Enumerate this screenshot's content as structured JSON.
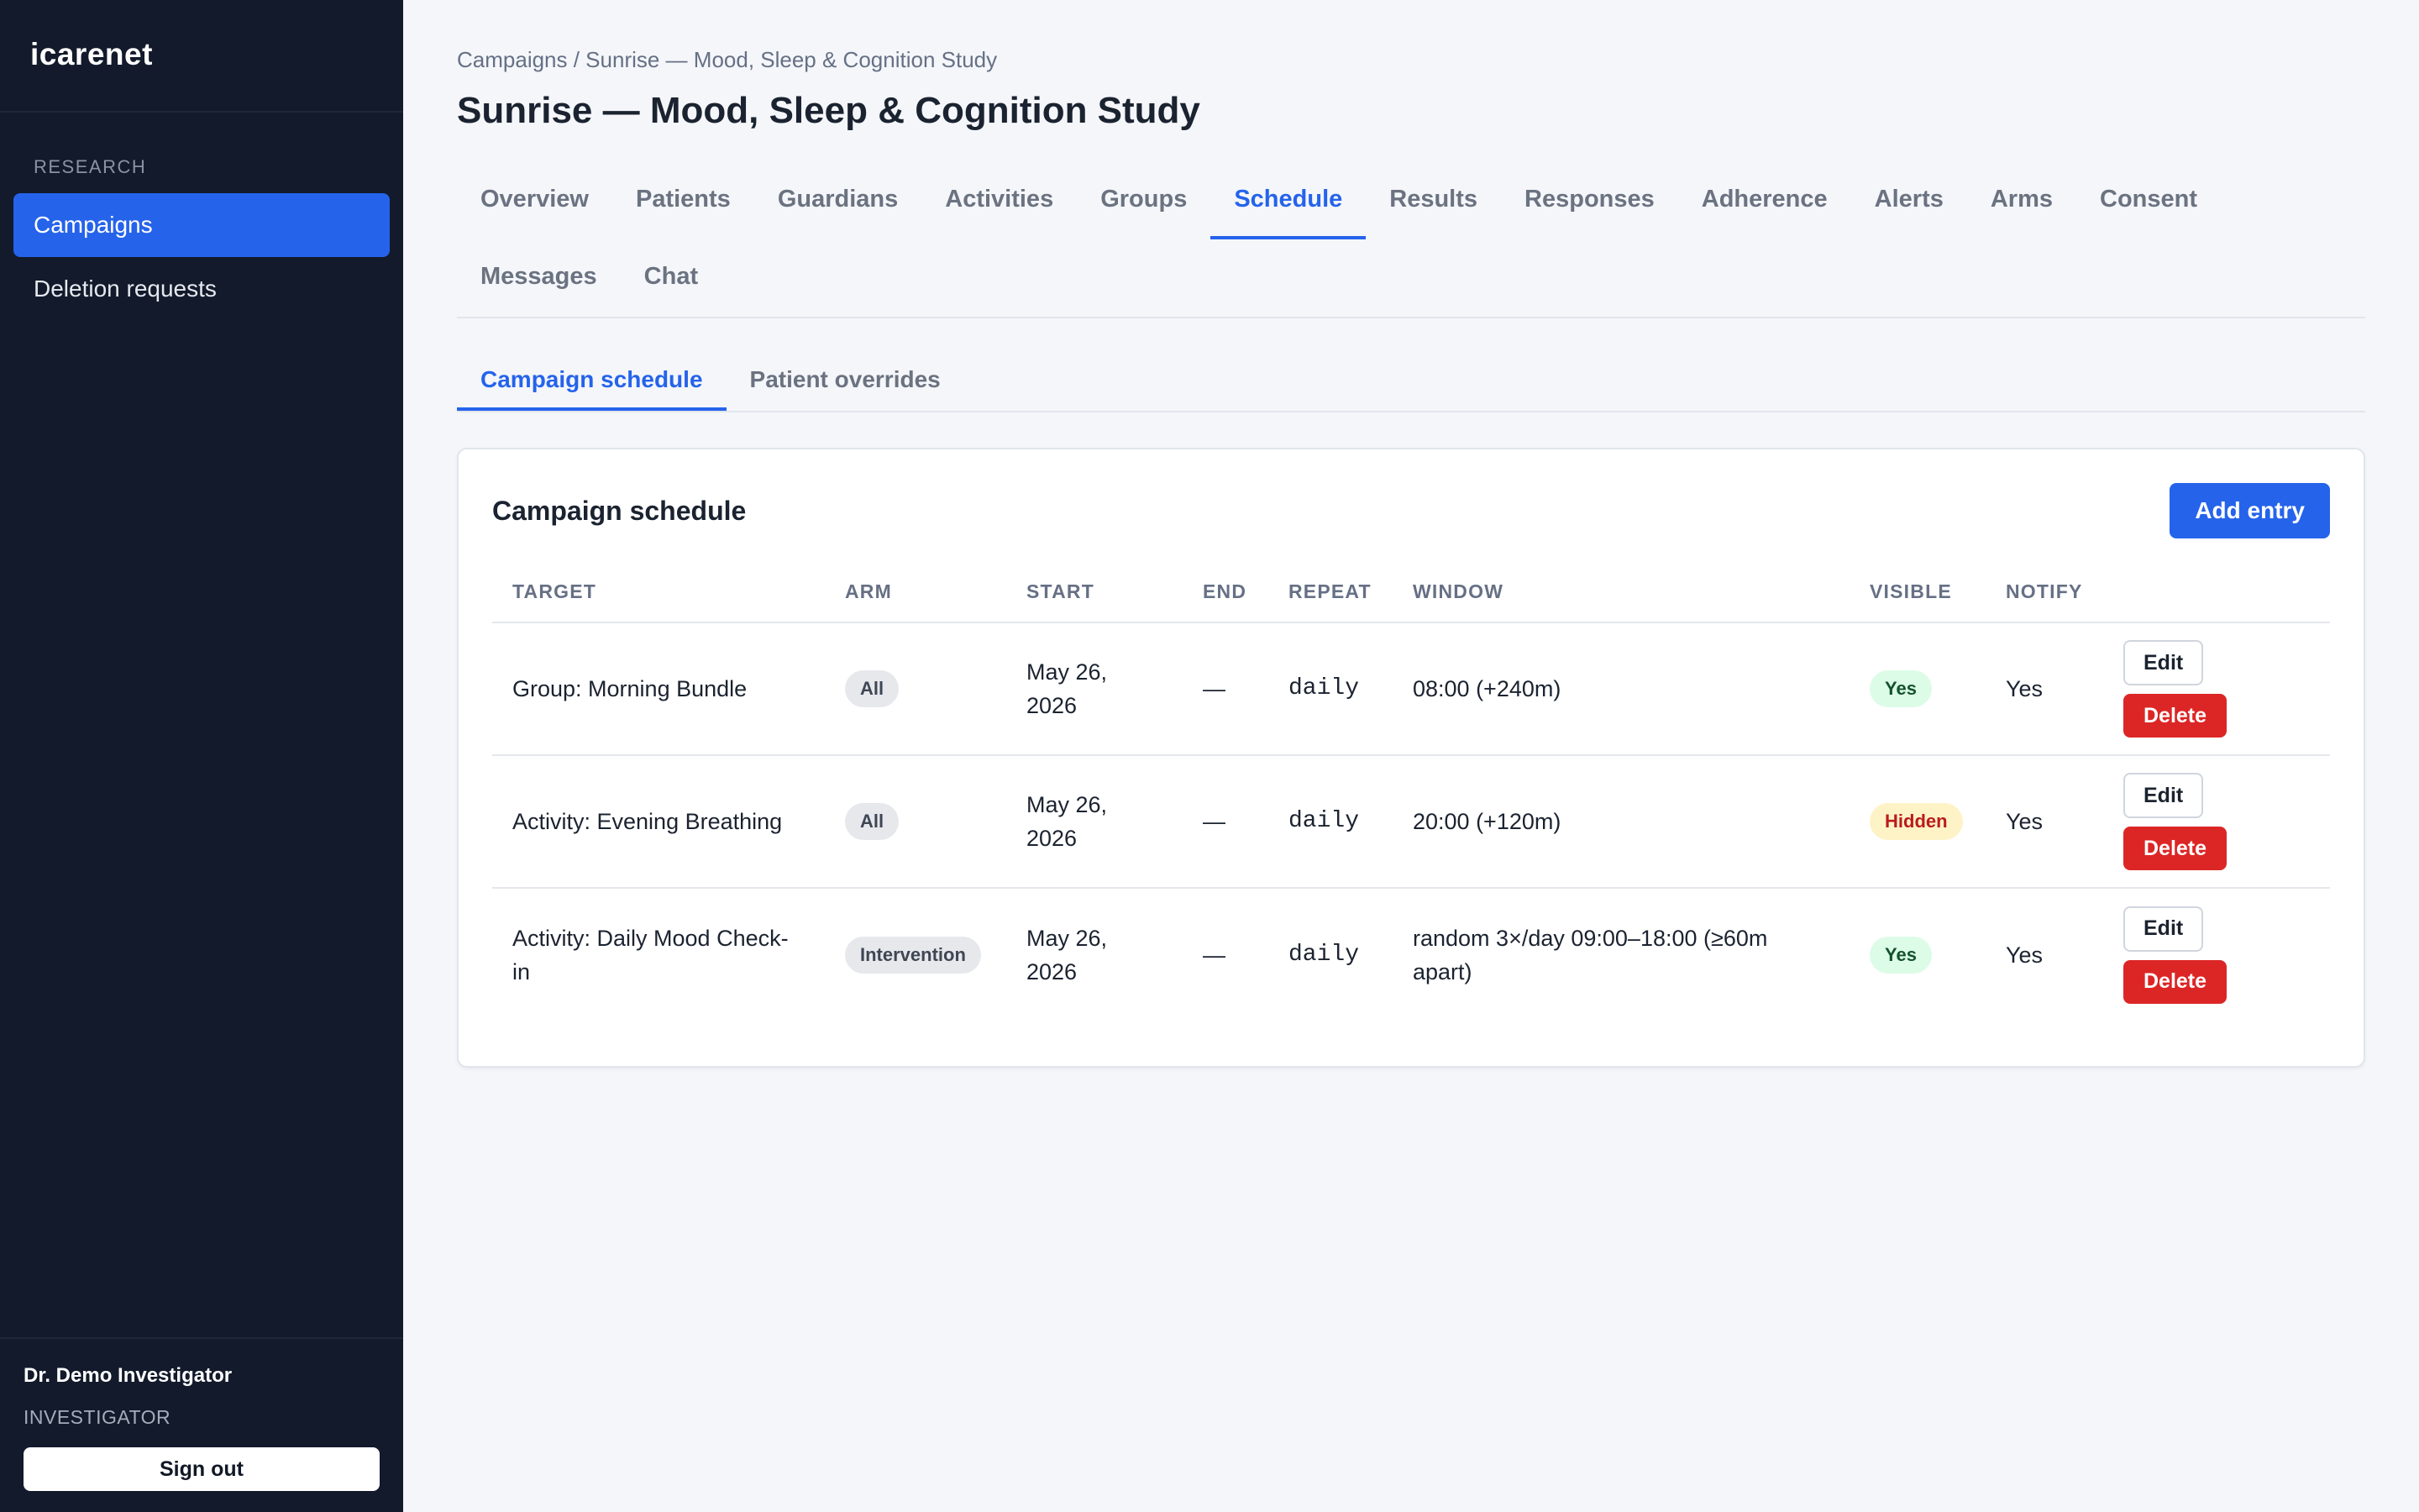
{
  "app": {
    "brand": "icarenet"
  },
  "sidebar": {
    "section_label": "RESEARCH",
    "items": [
      {
        "label": "Campaigns",
        "active": true
      },
      {
        "label": "Deletion requests",
        "active": false
      }
    ],
    "user": {
      "name": "Dr. Demo Investigator",
      "role": "INVESTIGATOR"
    },
    "signout_label": "Sign out"
  },
  "header": {
    "breadcrumb": "Campaigns / Sunrise — Mood, Sleep & Cognition Study",
    "title": "Sunrise — Mood, Sleep & Cognition Study"
  },
  "tabs": [
    {
      "label": "Overview"
    },
    {
      "label": "Patients"
    },
    {
      "label": "Guardians"
    },
    {
      "label": "Activities"
    },
    {
      "label": "Groups"
    },
    {
      "label": "Schedule",
      "active": true
    },
    {
      "label": "Results"
    },
    {
      "label": "Responses"
    },
    {
      "label": "Adherence"
    },
    {
      "label": "Alerts"
    },
    {
      "label": "Arms"
    },
    {
      "label": "Consent"
    },
    {
      "label": "Messages"
    },
    {
      "label": "Chat"
    }
  ],
  "subtabs": [
    {
      "label": "Campaign schedule",
      "active": true
    },
    {
      "label": "Patient overrides"
    }
  ],
  "schedule": {
    "title": "Campaign schedule",
    "add_label": "Add entry",
    "columns": [
      "TARGET",
      "ARM",
      "START",
      "END",
      "REPEAT",
      "WINDOW",
      "VISIBLE",
      "NOTIFY",
      ""
    ],
    "rows": [
      {
        "target": "Group: Morning Bundle",
        "arm": "All",
        "start": "May 26, 2026",
        "end": "—",
        "repeat": "daily",
        "window": "08:00 (+240m)",
        "visible": "Yes",
        "notify": "Yes",
        "edit_label": "Edit",
        "delete_label": "Delete"
      },
      {
        "target": "Activity: Evening Breathing",
        "arm": "All",
        "start": "May 26, 2026",
        "end": "—",
        "repeat": "daily",
        "window": "20:00 (+120m)",
        "visible": "Hidden",
        "notify": "Yes",
        "edit_label": "Edit",
        "delete_label": "Delete"
      },
      {
        "target": "Activity: Daily Mood Check-in",
        "arm": "Intervention",
        "start": "May 26, 2026",
        "end": "—",
        "repeat": "daily",
        "window": "random 3×/day 09:00–18:00 (≥60m apart)",
        "visible": "Yes",
        "notify": "Yes",
        "edit_label": "Edit",
        "delete_label": "Delete"
      }
    ]
  },
  "colors": {
    "sidebar_bg": "#121a2b",
    "accent": "#2563eb",
    "danger": "#dc2626",
    "visible_yes_bg": "#dcfce7",
    "visible_hidden_bg": "#fef3c7"
  }
}
